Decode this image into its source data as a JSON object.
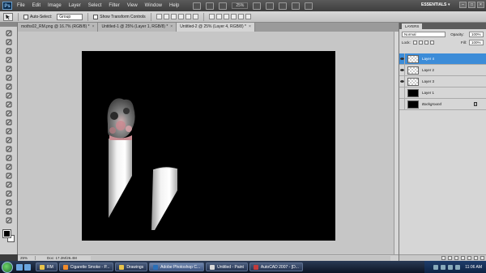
{
  "menubar": {
    "logo": "Ps",
    "items": [
      "File",
      "Edit",
      "Image",
      "Layer",
      "Select",
      "Filter",
      "View",
      "Window",
      "Help"
    ],
    "zoom": "25%",
    "workspace": "ESSENTIALS",
    "workspace_arrow": "▾"
  },
  "options": {
    "auto_select_label": "Auto-Select:",
    "auto_select_value": "Group",
    "transform_label": "Show Transform Controls"
  },
  "tabs": [
    {
      "label": "moths02_RM.png @ 16.7% (RGB/8) *"
    },
    {
      "label": "Untitled-1 @ 25% (Layer 1, RGB/8) *"
    },
    {
      "label": "Untitled-2 @ 25% (Layer 4, RGB/8) *"
    }
  ],
  "status": {
    "zoom": "25%",
    "doc": "Doc: 17.2M/26.4M"
  },
  "layers_panel": {
    "tab": "LAYERS",
    "blend": "Normal",
    "opacity_label": "Opacity:",
    "opacity_value": "100%",
    "lock_label": "Lock:",
    "fill_label": "Fill:",
    "fill_value": "100%",
    "layers": [
      {
        "name": "Layer 4"
      },
      {
        "name": "Layer 2"
      },
      {
        "name": "Layer 3"
      },
      {
        "name": "Layer 1"
      },
      {
        "name": "Background"
      }
    ]
  },
  "taskbar": {
    "items": [
      {
        "label": "RM"
      },
      {
        "label": "Cigarette Smoke - P..."
      },
      {
        "label": "Drawings"
      },
      {
        "label": "Adobe Photoshop C..."
      },
      {
        "label": "Untitled - Paint"
      },
      {
        "label": "AutoCAD 2007 - [D..."
      }
    ],
    "clock": "11:06 AM"
  },
  "colors": {
    "selected_layer": "#3c8cd8",
    "canvas": "#000000"
  }
}
